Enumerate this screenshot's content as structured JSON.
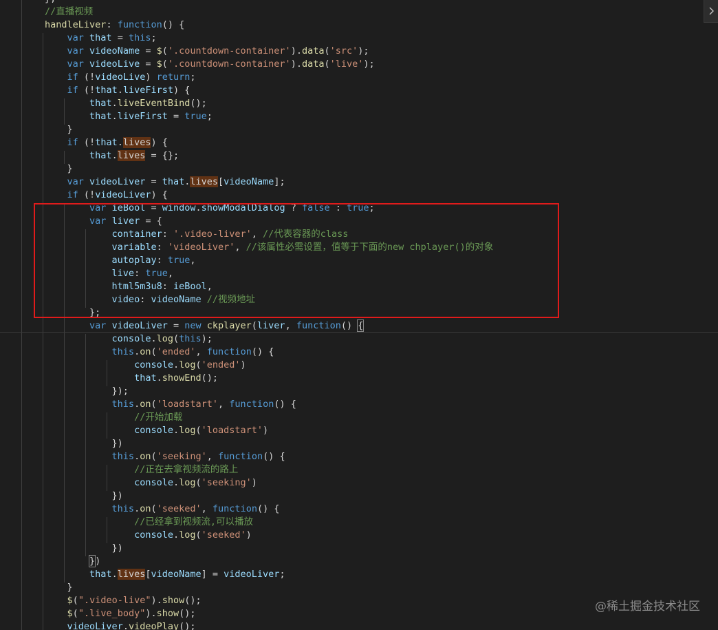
{
  "editor": {
    "lines": [
      [
        [
          "pl",
          "        };"
        ]
      ],
      [
        [
          "cmt",
          "        //直播视频"
        ]
      ],
      [
        [
          "fn",
          "        handleLiver"
        ],
        [
          "pl",
          ": "
        ],
        [
          "kw",
          "function"
        ],
        [
          "pl",
          "() {"
        ]
      ],
      [
        [
          "kw",
          "            var"
        ],
        [
          "var",
          " that"
        ],
        [
          "pl",
          " = "
        ],
        [
          "kw",
          "this"
        ],
        [
          "pl",
          ";"
        ]
      ],
      [
        [
          "kw",
          "            var"
        ],
        [
          "var",
          " videoName"
        ],
        [
          "pl",
          " = "
        ],
        [
          "fn",
          "$"
        ],
        [
          "pl",
          "("
        ],
        [
          "str",
          "'.countdown-container'"
        ],
        [
          "pl",
          ")."
        ],
        [
          "fn",
          "data"
        ],
        [
          "pl",
          "("
        ],
        [
          "str",
          "'src'"
        ],
        [
          "pl",
          ");"
        ]
      ],
      [
        [
          "kw",
          "            var"
        ],
        [
          "var",
          " videoLive"
        ],
        [
          "pl",
          " = "
        ],
        [
          "fn",
          "$"
        ],
        [
          "pl",
          "("
        ],
        [
          "str",
          "'.countdown-container'"
        ],
        [
          "pl",
          ")."
        ],
        [
          "fn",
          "data"
        ],
        [
          "pl",
          "("
        ],
        [
          "str",
          "'live'"
        ],
        [
          "pl",
          ");"
        ]
      ],
      [
        [
          "kw",
          "            if"
        ],
        [
          "pl",
          " (!"
        ],
        [
          "var",
          "videoLive"
        ],
        [
          "pl",
          ") "
        ],
        [
          "kw",
          "return"
        ],
        [
          "pl",
          ";"
        ]
      ],
      [
        [
          "kw",
          "            if"
        ],
        [
          "pl",
          " (!"
        ],
        [
          "var",
          "that"
        ],
        [
          "pl",
          "."
        ],
        [
          "var",
          "liveFirst"
        ],
        [
          "pl",
          ") {"
        ]
      ],
      [
        [
          "var",
          "                that"
        ],
        [
          "pl",
          "."
        ],
        [
          "fn",
          "liveEventBind"
        ],
        [
          "pl",
          "();"
        ]
      ],
      [
        [
          "var",
          "                that"
        ],
        [
          "pl",
          "."
        ],
        [
          "var",
          "liveFirst"
        ],
        [
          "pl",
          " = "
        ],
        [
          "kw",
          "true"
        ],
        [
          "pl",
          ";"
        ]
      ],
      [
        [
          "pl",
          "            }"
        ]
      ],
      [
        [
          "kw",
          "            if"
        ],
        [
          "pl",
          " (!"
        ],
        [
          "var",
          "that"
        ],
        [
          "pl",
          "."
        ],
        [
          "hl",
          "lives"
        ],
        [
          "pl",
          ") {"
        ]
      ],
      [
        [
          "var",
          "                that"
        ],
        [
          "pl",
          "."
        ],
        [
          "hl",
          "lives"
        ],
        [
          "pl",
          " = {};"
        ]
      ],
      [
        [
          "pl",
          "            }"
        ]
      ],
      [
        [
          "kw",
          "            var"
        ],
        [
          "var",
          " videoLiver"
        ],
        [
          "pl",
          " = "
        ],
        [
          "var",
          "that"
        ],
        [
          "pl",
          "."
        ],
        [
          "hl",
          "lives"
        ],
        [
          "pl",
          "["
        ],
        [
          "var",
          "videoName"
        ],
        [
          "pl",
          "];"
        ]
      ],
      [
        [
          "kw",
          "            if"
        ],
        [
          "pl",
          " (!"
        ],
        [
          "var",
          "videoLiver"
        ],
        [
          "pl",
          ") {"
        ]
      ],
      [
        [
          "kw",
          "                var"
        ],
        [
          "var",
          " ieBool"
        ],
        [
          "pl",
          " = "
        ],
        [
          "var",
          "window"
        ],
        [
          "pl",
          "."
        ],
        [
          "var",
          "showModalDialog"
        ],
        [
          "pl",
          " ? "
        ],
        [
          "kw",
          "false"
        ],
        [
          "pl",
          " : "
        ],
        [
          "kw",
          "true"
        ],
        [
          "pl",
          ";"
        ]
      ],
      [
        [
          "kw",
          "                var"
        ],
        [
          "var",
          " liver"
        ],
        [
          "pl",
          " = {"
        ]
      ],
      [
        [
          "var",
          "                    container"
        ],
        [
          "pl",
          ": "
        ],
        [
          "str",
          "'.video-liver'"
        ],
        [
          "pl",
          ", "
        ],
        [
          "cmt",
          "//代表容器的class"
        ]
      ],
      [
        [
          "var",
          "                    variable"
        ],
        [
          "pl",
          ": "
        ],
        [
          "str",
          "'videoLiver'"
        ],
        [
          "pl",
          ", "
        ],
        [
          "cmt",
          "//该属性必需设置，值等于下面的new chplayer()的对象"
        ]
      ],
      [
        [
          "var",
          "                    autoplay"
        ],
        [
          "pl",
          ": "
        ],
        [
          "kw",
          "true"
        ],
        [
          "pl",
          ","
        ]
      ],
      [
        [
          "var",
          "                    live"
        ],
        [
          "pl",
          ": "
        ],
        [
          "kw",
          "true"
        ],
        [
          "pl",
          ","
        ]
      ],
      [
        [
          "var",
          "                    html5m3u8"
        ],
        [
          "pl",
          ": "
        ],
        [
          "var",
          "ieBool"
        ],
        [
          "pl",
          ","
        ]
      ],
      [
        [
          "var",
          "                    video"
        ],
        [
          "pl",
          ": "
        ],
        [
          "var",
          "videoName"
        ],
        [
          "pl",
          " "
        ],
        [
          "cmt",
          "//视频地址"
        ]
      ],
      [
        [
          "pl",
          "                };"
        ]
      ],
      [
        [
          "kw",
          "                var"
        ],
        [
          "var",
          " videoLiver"
        ],
        [
          "pl",
          " = "
        ],
        [
          "kw",
          "new"
        ],
        [
          "fn",
          " ckplayer"
        ],
        [
          "pl",
          "("
        ],
        [
          "var",
          "liver"
        ],
        [
          "pl",
          ", "
        ],
        [
          "kw",
          "function"
        ],
        [
          "pl",
          "() "
        ],
        [
          "br",
          "{"
        ]
      ],
      [
        [
          "var",
          "                    console"
        ],
        [
          "pl",
          "."
        ],
        [
          "fn",
          "log"
        ],
        [
          "pl",
          "("
        ],
        [
          "kw",
          "this"
        ],
        [
          "pl",
          ");"
        ]
      ],
      [
        [
          "kw",
          "                    this"
        ],
        [
          "pl",
          "."
        ],
        [
          "fn",
          "on"
        ],
        [
          "pl",
          "("
        ],
        [
          "str",
          "'ended'"
        ],
        [
          "pl",
          ", "
        ],
        [
          "kw",
          "function"
        ],
        [
          "pl",
          "() {"
        ]
      ],
      [
        [
          "var",
          "                        console"
        ],
        [
          "pl",
          "."
        ],
        [
          "fn",
          "log"
        ],
        [
          "pl",
          "("
        ],
        [
          "str",
          "'ended'"
        ],
        [
          "pl",
          ")"
        ]
      ],
      [
        [
          "var",
          "                        that"
        ],
        [
          "pl",
          "."
        ],
        [
          "fn",
          "showEnd"
        ],
        [
          "pl",
          "();"
        ]
      ],
      [
        [
          "pl",
          "                    });"
        ]
      ],
      [
        [
          "kw",
          "                    this"
        ],
        [
          "pl",
          "."
        ],
        [
          "fn",
          "on"
        ],
        [
          "pl",
          "("
        ],
        [
          "str",
          "'loadstart'"
        ],
        [
          "pl",
          ", "
        ],
        [
          "kw",
          "function"
        ],
        [
          "pl",
          "() {"
        ]
      ],
      [
        [
          "cmt",
          "                        //开始加载"
        ]
      ],
      [
        [
          "var",
          "                        console"
        ],
        [
          "pl",
          "."
        ],
        [
          "fn",
          "log"
        ],
        [
          "pl",
          "("
        ],
        [
          "str",
          "'loadstart'"
        ],
        [
          "pl",
          ")"
        ]
      ],
      [
        [
          "pl",
          "                    })"
        ]
      ],
      [
        [
          "kw",
          "                    this"
        ],
        [
          "pl",
          "."
        ],
        [
          "fn",
          "on"
        ],
        [
          "pl",
          "("
        ],
        [
          "str",
          "'seeking'"
        ],
        [
          "pl",
          ", "
        ],
        [
          "kw",
          "function"
        ],
        [
          "pl",
          "() {"
        ]
      ],
      [
        [
          "cmt",
          "                        //正在去拿视频流的路上"
        ]
      ],
      [
        [
          "var",
          "                        console"
        ],
        [
          "pl",
          "."
        ],
        [
          "fn",
          "log"
        ],
        [
          "pl",
          "("
        ],
        [
          "str",
          "'seeking'"
        ],
        [
          "pl",
          ")"
        ]
      ],
      [
        [
          "pl",
          "                    })"
        ]
      ],
      [
        [
          "kw",
          "                    this"
        ],
        [
          "pl",
          "."
        ],
        [
          "fn",
          "on"
        ],
        [
          "pl",
          "("
        ],
        [
          "str",
          "'seeked'"
        ],
        [
          "pl",
          ", "
        ],
        [
          "kw",
          "function"
        ],
        [
          "pl",
          "() {"
        ]
      ],
      [
        [
          "cmt",
          "                        //已经拿到视频流,可以播放"
        ]
      ],
      [
        [
          "var",
          "                        console"
        ],
        [
          "pl",
          "."
        ],
        [
          "fn",
          "log"
        ],
        [
          "pl",
          "("
        ],
        [
          "str",
          "'seeked'"
        ],
        [
          "pl",
          ")"
        ]
      ],
      [
        [
          "pl",
          "                    })"
        ]
      ],
      [
        [
          "pl",
          "                "
        ],
        [
          "br",
          "}"
        ],
        [
          "pl",
          ")"
        ]
      ],
      [
        [
          "var",
          "                that"
        ],
        [
          "pl",
          "."
        ],
        [
          "hl",
          "lives"
        ],
        [
          "pl",
          "["
        ],
        [
          "var",
          "videoName"
        ],
        [
          "pl",
          "] = "
        ],
        [
          "var",
          "videoLiver"
        ],
        [
          "pl",
          ";"
        ]
      ],
      [
        [
          "pl",
          "            }"
        ]
      ],
      [
        [
          "fn",
          "            $"
        ],
        [
          "pl",
          "("
        ],
        [
          "str",
          "\".video-live\""
        ],
        [
          "pl",
          ")."
        ],
        [
          "fn",
          "show"
        ],
        [
          "pl",
          "();"
        ]
      ],
      [
        [
          "fn",
          "            $"
        ],
        [
          "pl",
          "("
        ],
        [
          "str",
          "\".live_body\""
        ],
        [
          "pl",
          ")."
        ],
        [
          "fn",
          "show"
        ],
        [
          "pl",
          "();"
        ]
      ],
      [
        [
          "var",
          "            videoLiver"
        ],
        [
          "pl",
          "."
        ],
        [
          "fn",
          "videoPlay"
        ],
        [
          "pl",
          "();"
        ]
      ]
    ]
  },
  "expand_icon": "chevron-right-icon",
  "watermark": "@稀土掘金技术社区",
  "colors": {
    "background": "#1e1e1e",
    "keyword": "#569cd6",
    "variable": "#9cdcfe",
    "function": "#dcdcaa",
    "string": "#ce9178",
    "comment": "#6a9955",
    "highlight_box": "#e01b1b"
  }
}
